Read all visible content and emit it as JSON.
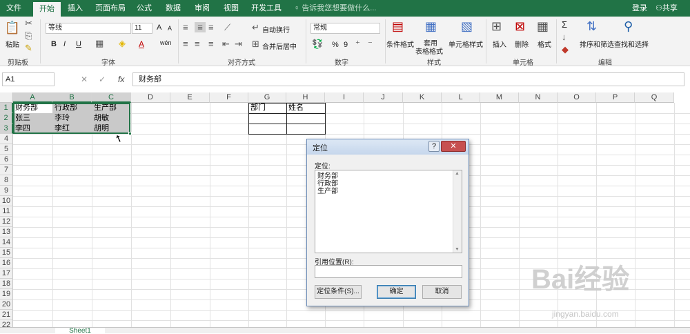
{
  "tabs": [
    "文件",
    "开始",
    "插入",
    "页面布局",
    "公式",
    "数据",
    "审阅",
    "视图",
    "开发工具"
  ],
  "tell_me": "告诉我您想要做什么...",
  "login": "登录",
  "share": "共享",
  "ribbon": {
    "clipboard": {
      "paste": "粘贴",
      "label": "剪贴板"
    },
    "font": {
      "name": "等线",
      "size": "11",
      "label": "字体",
      "bold": "B",
      "italic": "I",
      "underline": "U",
      "grow": "A",
      "shrink": "A",
      "color_a": "A",
      "wen": "wén"
    },
    "alignment": {
      "wrap": "自动换行",
      "merge": "合并后居中",
      "label": "对齐方式"
    },
    "number": {
      "format": "常规",
      "percent": "%",
      "comma": "9",
      "label": "数字"
    },
    "styles": {
      "conditional": "条件格式",
      "table1": "套用",
      "table2": "表格格式",
      "cell_styles": "单元格样式",
      "label": "样式"
    },
    "cells": {
      "insert": "插入",
      "delete": "删除",
      "format": "格式",
      "label": "单元格"
    },
    "editing": {
      "sort": "排序和筛选",
      "find": "查找和选择",
      "label": "编辑",
      "sigma": "Σ"
    }
  },
  "formula_bar": {
    "name_box": "A1",
    "fx": "fx",
    "content": "财务部"
  },
  "columns": [
    "A",
    "B",
    "C",
    "D",
    "E",
    "F",
    "G",
    "H",
    "I",
    "J",
    "K",
    "L",
    "M",
    "N",
    "O",
    "P",
    "Q"
  ],
  "rows": [
    "1",
    "2",
    "3",
    "4",
    "5",
    "6",
    "7",
    "8",
    "9",
    "10",
    "11",
    "12",
    "13",
    "14",
    "15",
    "16",
    "17",
    "18",
    "19",
    "20",
    "21",
    "22"
  ],
  "cells": {
    "A1": "财务部",
    "B1": "行政部",
    "C1": "生产部",
    "A2": "张三",
    "B2": "李玲",
    "C2": "胡敏",
    "A3": "李四",
    "B3": "李红",
    "C3": "胡明",
    "G1": "部门",
    "H1": "姓名"
  },
  "sheet_tab": "Sheet1",
  "dialog": {
    "title": "定位",
    "help": "?",
    "close": "✕",
    "goto_label": "定位:",
    "items": [
      "财务部",
      "行政部",
      "生产部"
    ],
    "ref_label": "引用位置(R):",
    "special_button": "定位条件(S)...",
    "ok_button": "确定",
    "cancel_button": "取消"
  },
  "watermark": {
    "brand": "Bai经验",
    "url": "jingyan.baidu.com"
  }
}
